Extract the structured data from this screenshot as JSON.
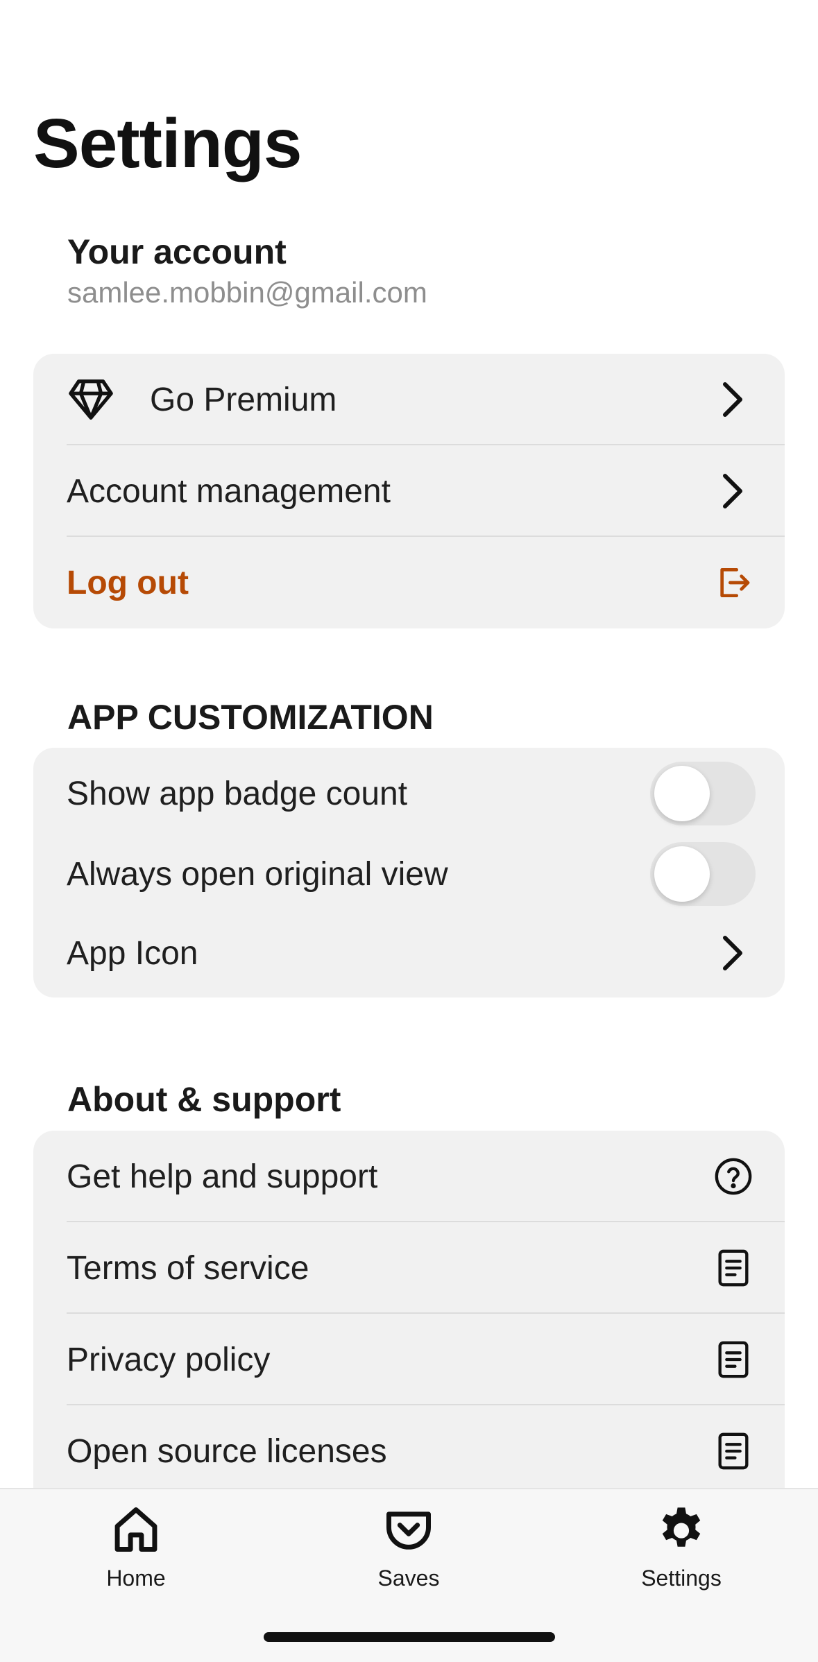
{
  "page": {
    "title": "Settings"
  },
  "account": {
    "label": "Your account",
    "email": "samlee.mobbin@gmail.com",
    "items": [
      {
        "label": "Go Premium",
        "left_icon": "diamond-icon",
        "right_icon": "chevron-right-icon"
      },
      {
        "label": "Account management",
        "right_icon": "chevron-right-icon"
      },
      {
        "label": "Log out",
        "right_icon": "logout-icon",
        "color": "#b64a05"
      }
    ]
  },
  "customization": {
    "heading": "APP CUSTOMIZATION",
    "items": [
      {
        "label": "Show app badge count",
        "toggle": false
      },
      {
        "label": "Always open original view",
        "toggle": false
      },
      {
        "label": "App Icon",
        "right_icon": "chevron-right-icon"
      }
    ]
  },
  "about": {
    "heading": "About & support",
    "items": [
      {
        "label": "Get help and support",
        "right_icon": "help-circle-icon"
      },
      {
        "label": "Terms of service",
        "right_icon": "document-icon"
      },
      {
        "label": "Privacy policy",
        "right_icon": "document-icon"
      },
      {
        "label": "Open source licenses",
        "right_icon": "document-icon"
      }
    ]
  },
  "tabbar": {
    "tabs": [
      {
        "label": "Home",
        "icon": "home-icon",
        "selected": false
      },
      {
        "label": "Saves",
        "icon": "saves-pocket-icon",
        "selected": false
      },
      {
        "label": "Settings",
        "icon": "gear-icon",
        "selected": true
      }
    ]
  },
  "colors": {
    "accent": "#b64a05",
    "card_bg": "#f1f1f1",
    "secondary_text": "#8e8e8e"
  }
}
